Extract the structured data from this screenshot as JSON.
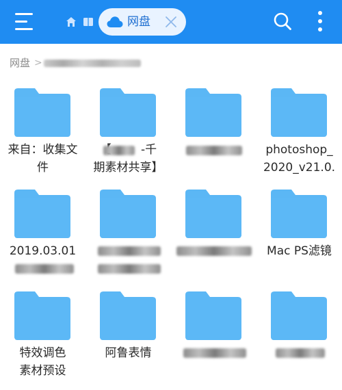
{
  "appbar": {
    "background": "#1f8cf2",
    "chip_label": "网盘",
    "icons": [
      "menu-icon",
      "home-icon",
      "book-icon",
      "cloud-icon",
      "close-icon",
      "search-icon",
      "more-vertical-icon"
    ]
  },
  "breadcrumb": {
    "root": "网盘",
    "separator": ">"
  },
  "folders": [
    {
      "name": "来自：收集文\n件"
    },
    {
      "name": "【        -千\n期素材共享】"
    },
    {
      "name": ""
    },
    {
      "name": "photoshop_\n2020_v21.0."
    },
    {
      "name": "2019.03.01"
    },
    {
      "name": ""
    },
    {
      "name": ""
    },
    {
      "name": "Mac PS滤镜"
    },
    {
      "name": "特效调色\n素材预设"
    },
    {
      "name": "阿鲁表情"
    },
    {
      "name": ""
    },
    {
      "name": ""
    }
  ],
  "colors": {
    "folder": "#5bb7f5",
    "folder_tab": "#5bb7f5",
    "text": "#2a2a2a",
    "muted": "#8a8a8a"
  }
}
